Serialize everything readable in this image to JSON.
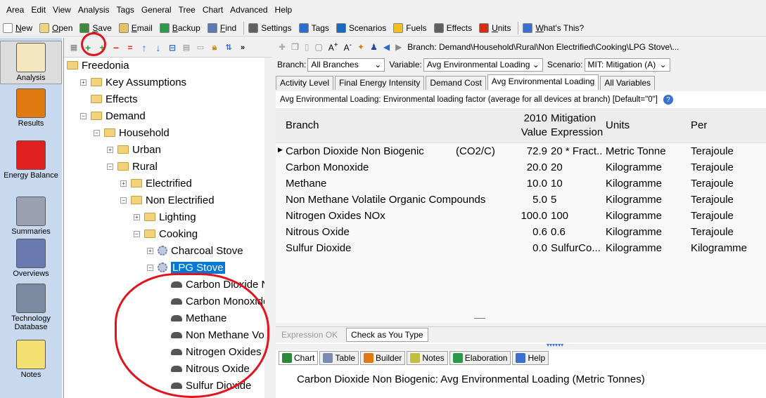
{
  "menu": [
    "Area",
    "Edit",
    "View",
    "Analysis",
    "Tags",
    "General",
    "Tree",
    "Chart",
    "Advanced",
    "Help"
  ],
  "toolbar": [
    {
      "label": "New",
      "u": "N",
      "rest": "ew",
      "icon": "new-icon",
      "color": "#ffffff"
    },
    {
      "label": "Open",
      "u": "O",
      "rest": "pen",
      "icon": "open-icon",
      "color": "#f2d27a"
    },
    {
      "label": "Save",
      "u": "S",
      "rest": "ave",
      "icon": "save-icon",
      "color": "#3a8a3a"
    },
    {
      "label": "Email",
      "u": "E",
      "rest": "mail",
      "icon": "email-icon",
      "color": "#e8c060"
    },
    {
      "label": "Backup",
      "u": "B",
      "rest": "ackup",
      "icon": "backup-icon",
      "color": "#2a9a4a"
    },
    {
      "label": "Find",
      "u": "F",
      "rest": "ind",
      "icon": "find-icon",
      "color": "#5a7ab0"
    },
    {
      "label": "Settings",
      "u": "",
      "rest": "Settings",
      "icon": "settings-icon",
      "color": "#606060"
    },
    {
      "label": "Tags",
      "u": "",
      "rest": "Tags",
      "icon": "tags-icon",
      "color": "#2a70d0"
    },
    {
      "label": "Scenarios",
      "u": "",
      "rest": "Scenarios",
      "icon": "scenarios-icon",
      "color": "#1a6ac0"
    },
    {
      "label": "Fuels",
      "u": "",
      "rest": "Fuels",
      "icon": "fuels-icon",
      "color": "#f0c020"
    },
    {
      "label": "Effects",
      "u": "",
      "rest": "Effects",
      "icon": "effects-icon",
      "color": "#606060"
    },
    {
      "label": "Units",
      "u": "U",
      "rest": "nits",
      "icon": "units-icon",
      "color": "#d03010"
    },
    {
      "label": "What's This?",
      "u": "W",
      "rest": "hat's This?",
      "icon": "whats-this-icon",
      "color": "#3b6fd0"
    }
  ],
  "views": [
    {
      "label": "Analysis",
      "icon": "analysis-icon",
      "active": true
    },
    {
      "label": "Results",
      "icon": "results-icon",
      "active": false
    },
    {
      "label": "Energy Balance",
      "icon": "energy-balance-icon",
      "active": false
    },
    {
      "label": "Summaries",
      "icon": "summaries-icon",
      "active": false
    },
    {
      "label": "Overviews",
      "icon": "overviews-icon",
      "active": false
    },
    {
      "label": "Technology Database",
      "icon": "technology-database-icon",
      "active": false
    },
    {
      "label": "Notes",
      "icon": "notes-icon",
      "active": false
    }
  ],
  "tree": [
    {
      "label": "Freedonia",
      "level": 0,
      "expander": "",
      "icon": "folder"
    },
    {
      "label": "Key Assumptions",
      "level": 1,
      "expander": "+",
      "icon": "folder"
    },
    {
      "label": "Effects",
      "level": 1,
      "expander": "",
      "icon": "folder"
    },
    {
      "label": "Demand",
      "level": 1,
      "expander": "-",
      "icon": "folder"
    },
    {
      "label": "Household",
      "level": 2,
      "expander": "-",
      "icon": "folder"
    },
    {
      "label": "Urban",
      "level": 3,
      "expander": "+",
      "icon": "folder"
    },
    {
      "label": "Rural",
      "level": 3,
      "expander": "-",
      "icon": "folder"
    },
    {
      "label": "Electrified",
      "level": 4,
      "expander": "+",
      "icon": "folder"
    },
    {
      "label": "Non Electrified",
      "level": 4,
      "expander": "-",
      "icon": "folder"
    },
    {
      "label": "Lighting",
      "level": 5,
      "expander": "+",
      "icon": "folder"
    },
    {
      "label": "Cooking",
      "level": 5,
      "expander": "-",
      "icon": "folder"
    },
    {
      "label": "Charcoal Stove",
      "level": 6,
      "expander": "+",
      "icon": "gear"
    },
    {
      "label": "LPG Stove",
      "level": 6,
      "expander": "-",
      "icon": "gear",
      "selected": true
    },
    {
      "label": "Carbon Dioxide N",
      "level": 7,
      "expander": "",
      "icon": "cloud"
    },
    {
      "label": "Carbon Monoxide",
      "level": 7,
      "expander": "",
      "icon": "cloud"
    },
    {
      "label": "Methane",
      "level": 7,
      "expander": "",
      "icon": "cloud"
    },
    {
      "label": "Non Methane Vol",
      "level": 7,
      "expander": "",
      "icon": "cloud"
    },
    {
      "label": "Nitrogen Oxides I",
      "level": 7,
      "expander": "",
      "icon": "cloud"
    },
    {
      "label": "Nitrous Oxide",
      "level": 7,
      "expander": "",
      "icon": "cloud"
    },
    {
      "label": "Sulfur Dioxide",
      "level": 7,
      "expander": "",
      "icon": "cloud"
    }
  ],
  "breadcrumb": "Branch: Demand\\Household\\Rural\\Non Electrified\\Cooking\\LPG Stove\\...",
  "selectors": {
    "branch_label": "Branch:",
    "branch_value": "All Branches",
    "variable_label": "Variable:",
    "variable_value": "Avg Environmental Loading",
    "scenario_label": "Scenario:",
    "scenario_value": "MIT: Mitigation (A)"
  },
  "tabs": [
    {
      "label": "Activity Level",
      "active": false
    },
    {
      "label": "Final Energy Intensity",
      "active": false
    },
    {
      "label": "Demand Cost",
      "active": false
    },
    {
      "label": "Avg Environmental Loading",
      "active": true
    },
    {
      "label": "All Variables",
      "active": false
    }
  ],
  "description": "Avg Environmental Loading: Environmental loading factor (average for all devices at branch) [Default=\"0\"]",
  "grid": {
    "headers": {
      "branch": "Branch",
      "value_line1": "2010",
      "value_line2": "Value",
      "expr_line1": "Mitigation",
      "expr_line2": "Expression",
      "units": "Units",
      "per": "Per"
    },
    "rows": [
      {
        "branch": "Carbon Dioxide Non Biogenic",
        "note": "(CO2/C)",
        "value": "72.9",
        "expression": "20 * Fract...",
        "units": "Metric Tonne",
        "per": "Terajoule",
        "current": true
      },
      {
        "branch": "Carbon Monoxide",
        "note": "",
        "value": "20.0",
        "expression": "20",
        "units": "Kilogramme",
        "per": "Terajoule",
        "current": false
      },
      {
        "branch": "Methane",
        "note": "",
        "value": "10.0",
        "expression": "10",
        "units": "Kilogramme",
        "per": "Terajoule",
        "current": false
      },
      {
        "branch": "Non Methane Volatile Organic Compounds",
        "note": "",
        "value": "5.0",
        "expression": "5",
        "units": "Kilogramme",
        "per": "Terajoule",
        "current": false
      },
      {
        "branch": "Nitrogen Oxides NOx",
        "note": "",
        "value": "100.0",
        "expression": "100",
        "units": "Kilogramme",
        "per": "Terajoule",
        "current": false
      },
      {
        "branch": "Nitrous Oxide",
        "note": "",
        "value": "0.6",
        "expression": "0.6",
        "units": "Kilogramme",
        "per": "Terajoule",
        "current": false
      },
      {
        "branch": "Sulfur Dioxide",
        "note": "",
        "value": "0.0",
        "expression": "SulfurCo...",
        "units": "Kilogramme",
        "per": "Kilogramme",
        "current": false
      }
    ]
  },
  "expression_bar": {
    "status": "Expression OK",
    "check": "Check as You Type"
  },
  "bottom_tabs": [
    {
      "label": "Chart",
      "icon": "chart-icon",
      "color": "#2a8a3a"
    },
    {
      "label": "Table",
      "icon": "table-icon",
      "color": "#7a8ab0"
    },
    {
      "label": "Builder",
      "icon": "builder-icon",
      "color": "#e07a10"
    },
    {
      "label": "Notes",
      "icon": "notes-tab-icon",
      "color": "#c0c040"
    },
    {
      "label": "Elaboration",
      "icon": "elaboration-icon",
      "color": "#2a9a4a"
    },
    {
      "label": "Help",
      "icon": "help-tab-icon",
      "color": "#3b6fd0"
    }
  ],
  "chart_title": "Carbon Dioxide Non Biogenic: Avg Environmental Loading (Metric Tonnes)"
}
